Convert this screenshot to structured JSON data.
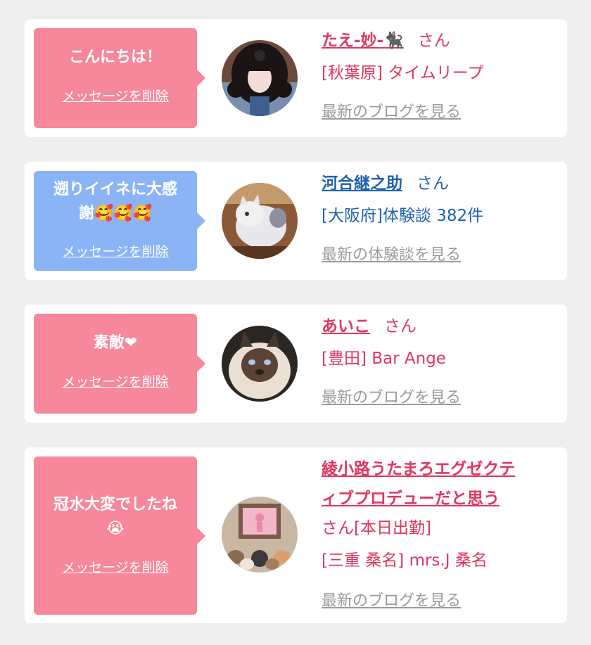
{
  "cards": [
    {
      "message": "こんにちは！",
      "delete_label": "メッセージを削除",
      "user_name": "たえ-妙-🐈‍⬛",
      "honorific": "さん",
      "shop": "[秋葉原] タイムリープ",
      "more_link": "最新のブログを見る",
      "avatar_icon": "girl-gothic-avatar",
      "theme": "pink"
    },
    {
      "message_line1": "遡りイイネに大感",
      "message_line2": "謝🥰🥰🥰",
      "delete_label": "メッセージを削除",
      "user_name": "河合継之助",
      "honorific": "さん",
      "shop": "[大阪府]体験談 382件",
      "more_link": "最新の体験談を見る",
      "avatar_icon": "plush-cat-avatar",
      "theme": "blue"
    },
    {
      "message": "素敵❤",
      "delete_label": "メッセージを削除",
      "user_name": "あいこ",
      "honorific": "さん",
      "shop": "[豊田] Bar Ange",
      "more_link": "最新のブログを見る",
      "avatar_icon": "himalayan-cat-avatar",
      "theme": "pink"
    },
    {
      "message_line1": "冠水大変でしたね",
      "message_line2": "😭",
      "delete_label": "メッセージを削除",
      "user_name_line1": "綾小路うたまろエグゼクテ",
      "user_name_line2": "ィブプロデューだと思う",
      "honorific_status": "さん[本日出勤]",
      "shop": "[三重 桑名] mrs.J 桑名",
      "more_link": "最新のブログを見る",
      "avatar_icon": "cats-gallery-avatar",
      "theme": "pink"
    }
  ],
  "colors": {
    "pink_bubble": "#f7879b",
    "blue_bubble": "#8ab4f5",
    "pink_text": "#e0365f",
    "blue_text": "#1f63ad",
    "link_gray": "#9a9a9a",
    "background": "#efefef"
  }
}
